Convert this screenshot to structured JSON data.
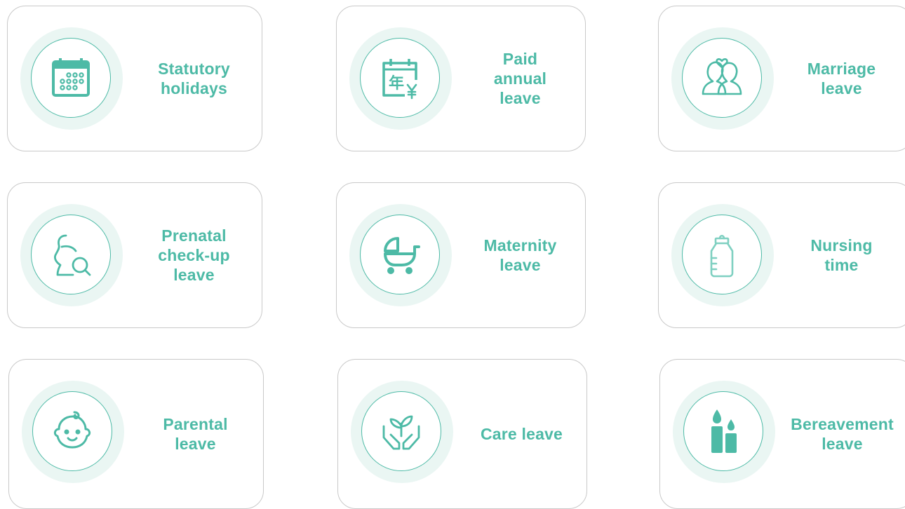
{
  "accent_color": "#4dbaa6",
  "halo_color": "#eaf6f3",
  "cards": [
    {
      "label_lines": [
        "Statutory",
        "holidays"
      ],
      "icon": "calendar-icon"
    },
    {
      "label_lines": [
        "Paid",
        "annual",
        "leave"
      ],
      "icon": "calendar-yen-icon",
      "icon_text": "年"
    },
    {
      "label_lines": [
        "Marriage",
        "leave"
      ],
      "icon": "couple-heart-icon"
    },
    {
      "label_lines": [
        "Prenatal",
        "check-up",
        "leave"
      ],
      "icon": "pregnant-search-icon"
    },
    {
      "label_lines": [
        "Maternity",
        "leave"
      ],
      "icon": "baby-carriage-icon"
    },
    {
      "label_lines": [
        "Nursing",
        "time"
      ],
      "icon": "baby-bottle-icon"
    },
    {
      "label_lines": [
        "Parental",
        "leave"
      ],
      "icon": "baby-face-icon"
    },
    {
      "label_lines": [
        "Care leave"
      ],
      "icon": "hands-sprout-icon"
    },
    {
      "label_lines": [
        "Bereavement",
        "leave"
      ],
      "icon": "candles-icon"
    }
  ]
}
